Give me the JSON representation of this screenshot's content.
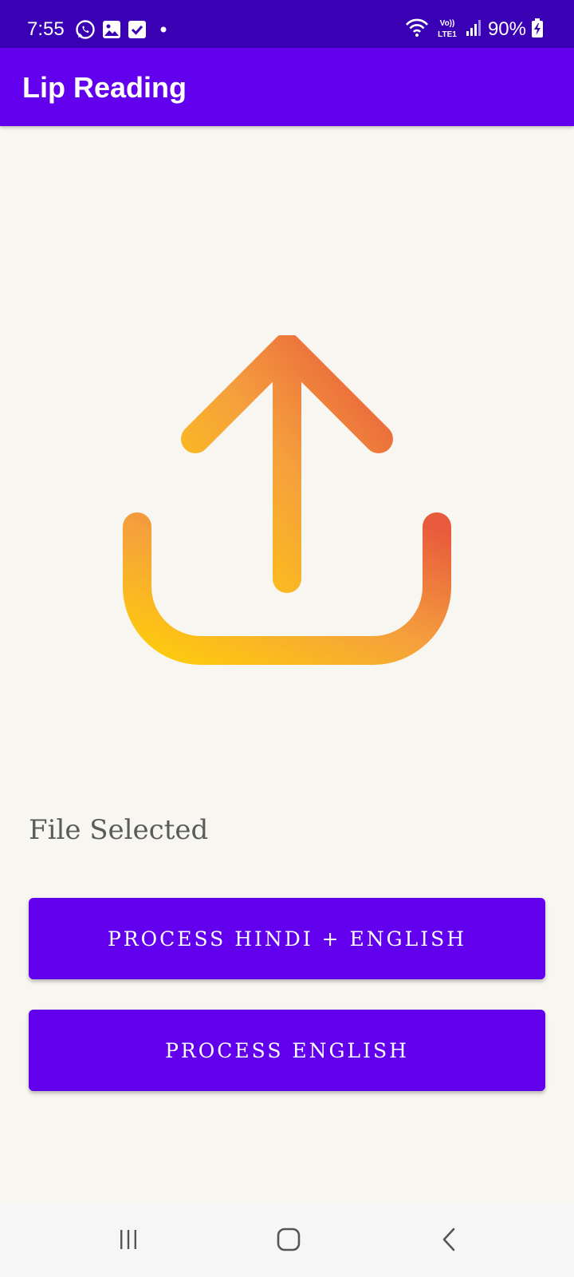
{
  "status_bar": {
    "time": "7:55",
    "battery_percent": "90%",
    "network_label": "VoLTE1",
    "left_icons": [
      "whatsapp-icon",
      "gallery-icon",
      "checkbox-icon",
      "dot-icon"
    ],
    "right_icons": [
      "wifi-icon",
      "volte-icon",
      "signal-icon",
      "battery-charging-icon"
    ],
    "background_color": "#3a00b4"
  },
  "app_bar": {
    "title": "Lip Reading",
    "background_color": "#6200ee"
  },
  "main": {
    "upload_icon": "upload-icon",
    "upload_gradient": [
      "#fecb0d",
      "#f5a03d",
      "#e85a3c"
    ],
    "file_status": "File Selected",
    "buttons": [
      {
        "label": "PROCESS HINDI + ENGLISH"
      },
      {
        "label": "PROCESS ENGLISH"
      }
    ],
    "button_color": "#6200ee"
  },
  "navigation_bar": {
    "buttons": [
      "recent-apps-icon",
      "home-icon",
      "back-icon"
    ]
  }
}
